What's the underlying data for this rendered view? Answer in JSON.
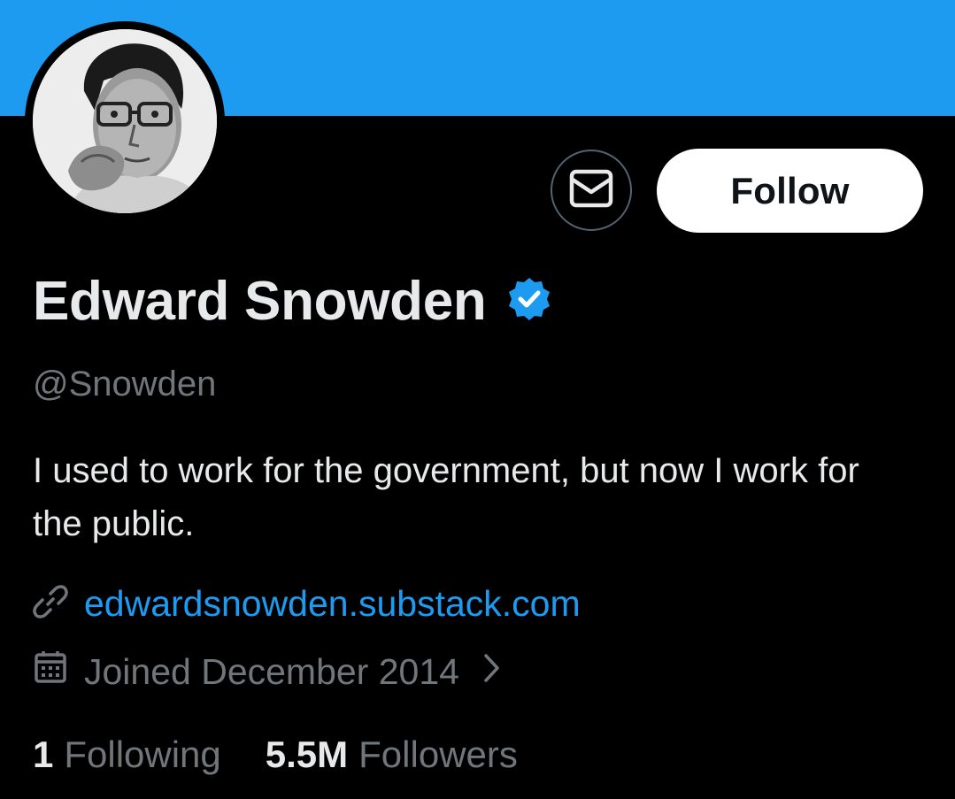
{
  "colors": {
    "banner": "#1d9bf0",
    "background": "#000000",
    "primary_text": "#e7e9ea",
    "secondary_text": "#71767b",
    "link": "#1d9bf0",
    "follow_button_bg": "#ffffff",
    "follow_button_text": "#0f1419"
  },
  "profile": {
    "display_name": "Edward Snowden",
    "verified_icon": "verified-badge-icon",
    "handle": "@Snowden",
    "bio": "I used to work for the government, but now I work for the public.",
    "link_icon": "link-icon",
    "website": "edwardsnowden.substack.com",
    "joined_icon": "calendar-icon",
    "joined": "Joined December 2014",
    "joined_chevron_icon": "chevron-right-icon"
  },
  "actions": {
    "message_icon": "envelope-icon",
    "follow_label": "Follow"
  },
  "stats": {
    "following_count": "1",
    "following_label": "Following",
    "followers_count": "5.5M",
    "followers_label": "Followers"
  }
}
